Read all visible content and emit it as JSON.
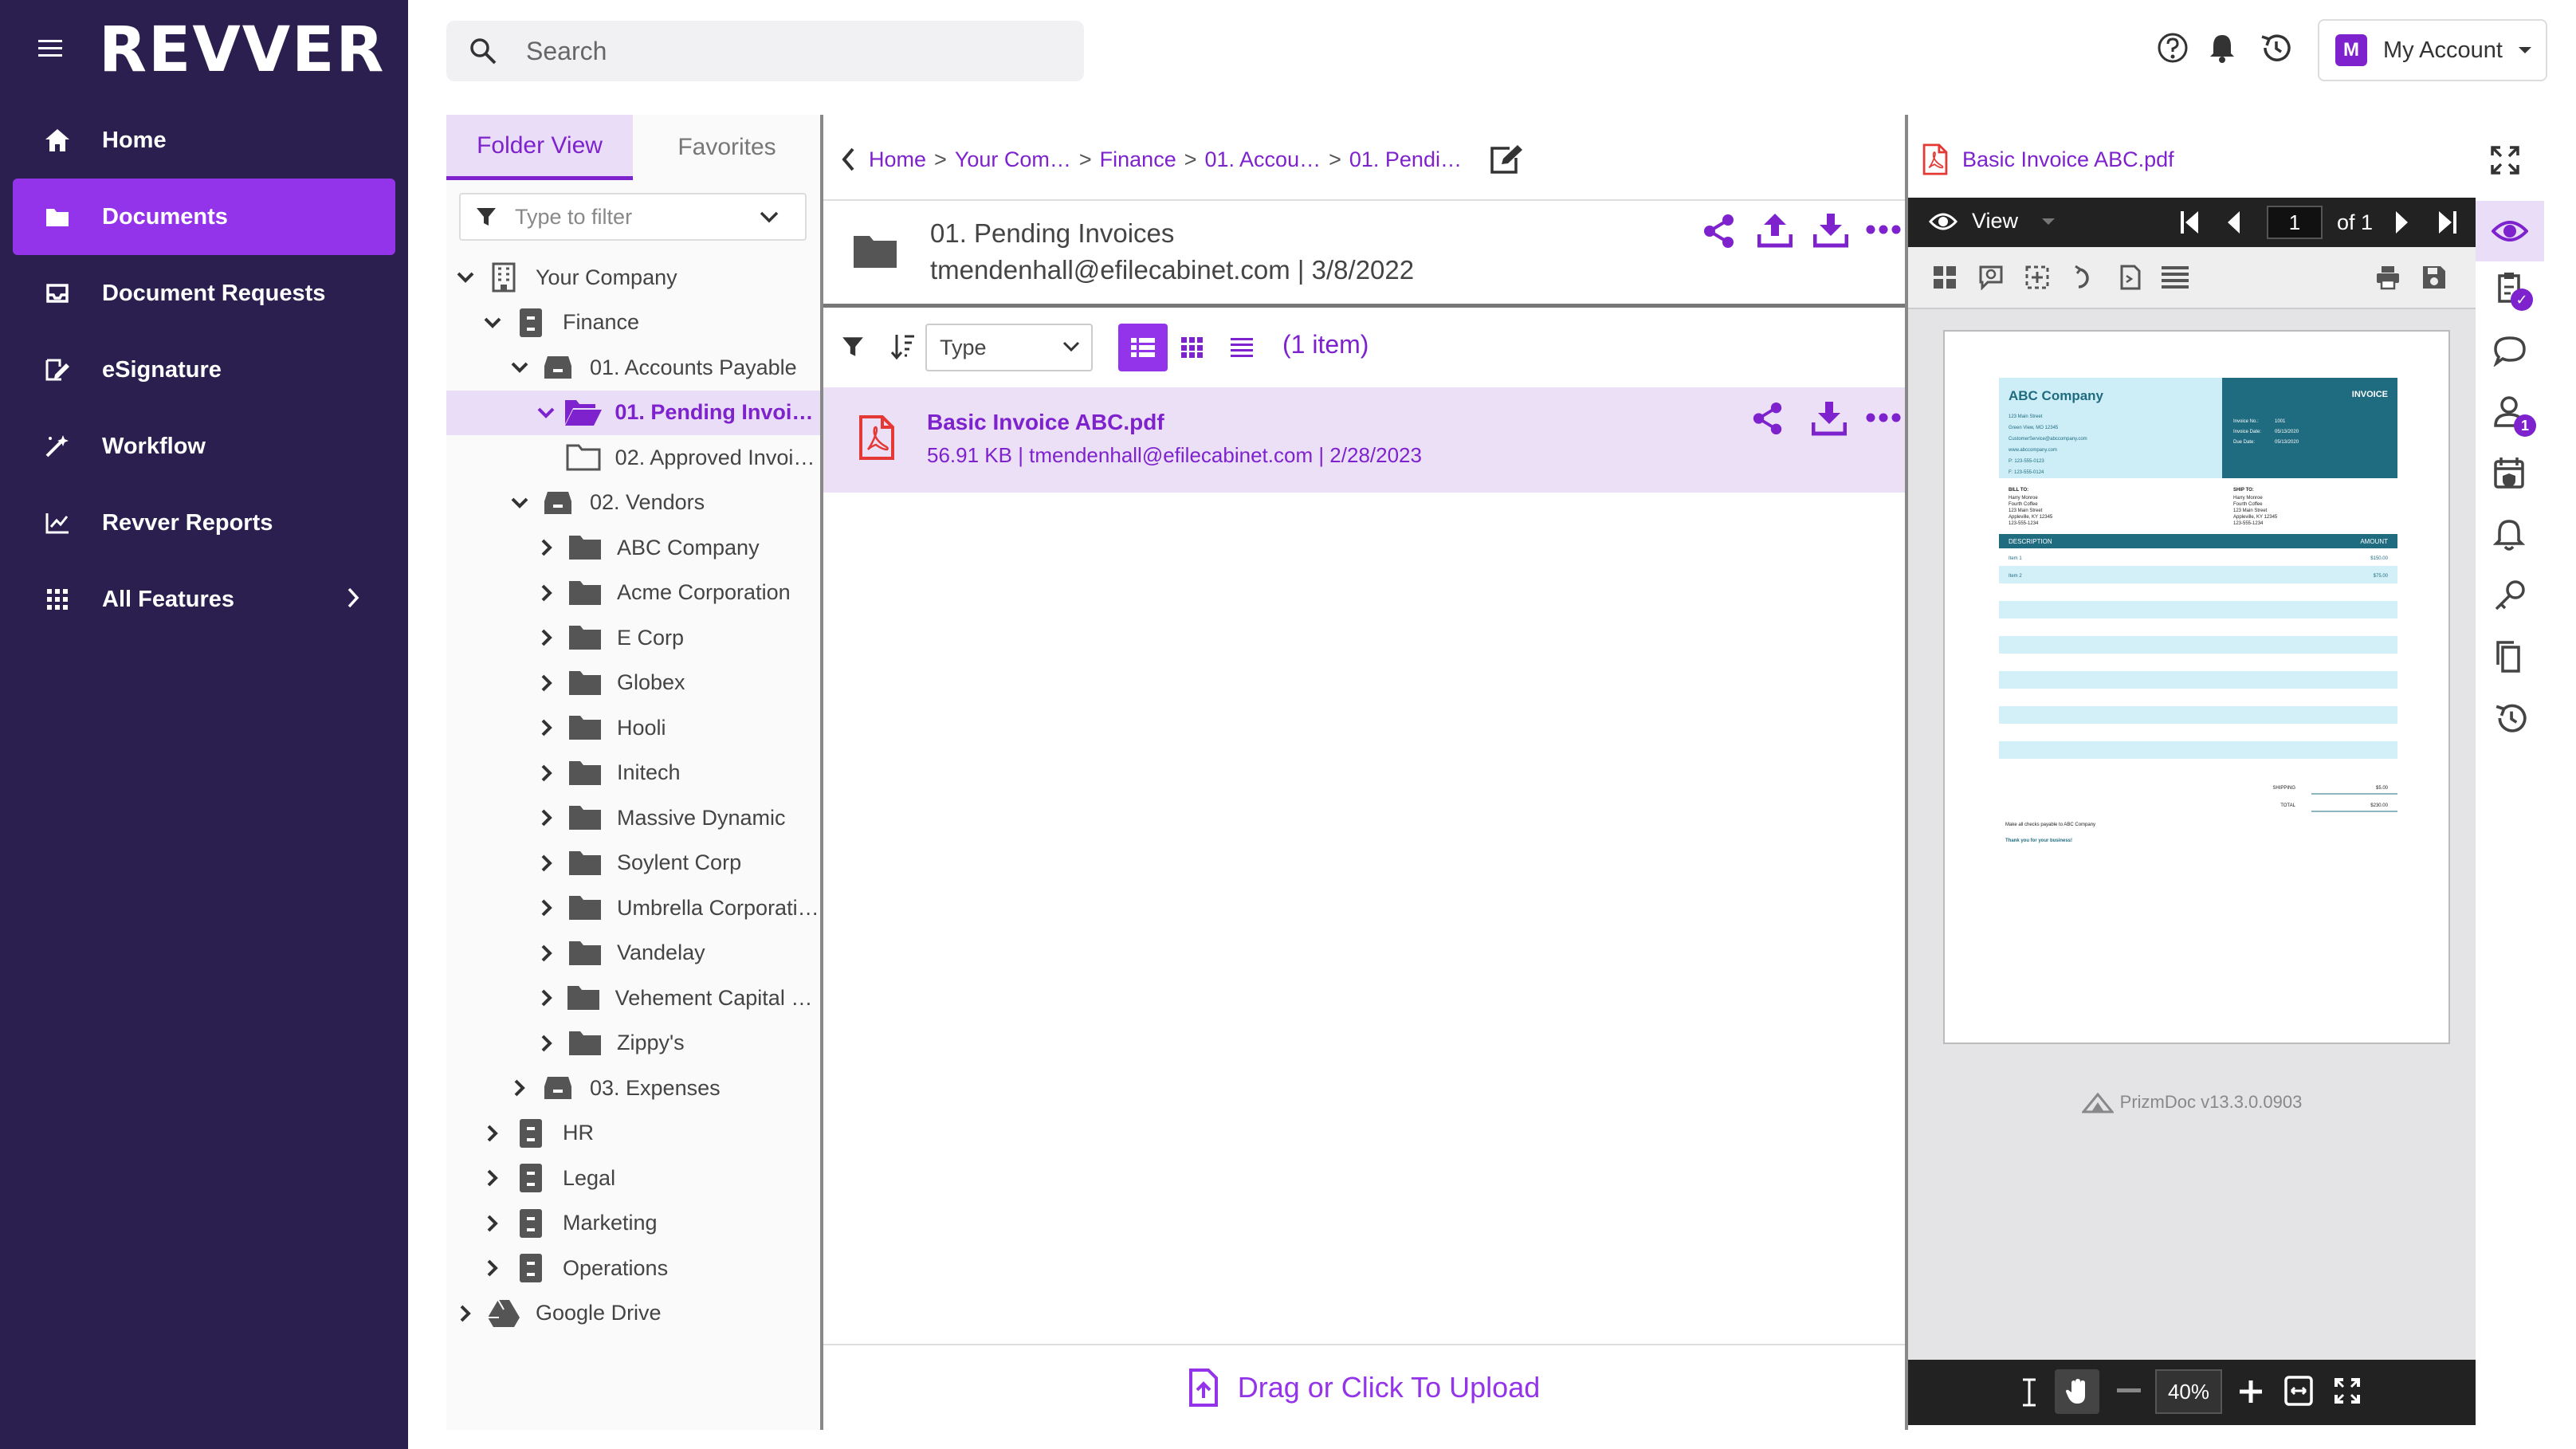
{
  "app": {
    "logo_text": "REVVER",
    "brand_color": "#7e22ce",
    "nav_bg": "#2a1f4e",
    "active_nav": "#9333ea"
  },
  "nav": {
    "items": [
      {
        "label": "Home",
        "icon": "home-icon"
      },
      {
        "label": "Documents",
        "icon": "folder-icon",
        "active": true
      },
      {
        "label": "Document Requests",
        "icon": "inbox-icon"
      },
      {
        "label": "eSignature",
        "icon": "signature-icon"
      },
      {
        "label": "Workflow",
        "icon": "magic-wand-icon"
      },
      {
        "label": "Revver Reports",
        "icon": "chart-icon"
      },
      {
        "label": "All Features",
        "icon": "grid-icon"
      }
    ]
  },
  "search": {
    "placeholder": "Search"
  },
  "account": {
    "initial": "M",
    "label": "My Account"
  },
  "tree": {
    "tabs": [
      "Folder View",
      "Favorites"
    ],
    "filter_placeholder": "Type to filter",
    "nodes": [
      {
        "label": "Your Company",
        "type": "building",
        "toggle": "open",
        "level": 0
      },
      {
        "label": "Finance",
        "type": "cabinet",
        "toggle": "open",
        "level": 1
      },
      {
        "label": "01. Accounts Payable",
        "type": "drawer",
        "toggle": "open",
        "level": 2
      },
      {
        "label": "01. Pending Invoices",
        "type": "folder-open",
        "toggle": "open",
        "level": 3,
        "selected": true
      },
      {
        "label": "02. Approved Invoices",
        "type": "folder-empty",
        "toggle": "none",
        "level": 3
      },
      {
        "label": "02. Vendors",
        "type": "drawer",
        "toggle": "open",
        "level": 2
      },
      {
        "label": "ABC Company",
        "type": "folder",
        "toggle": "closed",
        "level": 3
      },
      {
        "label": "Acme Corporation",
        "type": "folder",
        "toggle": "closed",
        "level": 3
      },
      {
        "label": "E Corp",
        "type": "folder",
        "toggle": "closed",
        "level": 3
      },
      {
        "label": "Globex",
        "type": "folder",
        "toggle": "closed",
        "level": 3
      },
      {
        "label": "Hooli",
        "type": "folder",
        "toggle": "closed",
        "level": 3
      },
      {
        "label": "Initech",
        "type": "folder",
        "toggle": "closed",
        "level": 3
      },
      {
        "label": "Massive Dynamic",
        "type": "folder",
        "toggle": "closed",
        "level": 3
      },
      {
        "label": "Soylent Corp",
        "type": "folder",
        "toggle": "closed",
        "level": 3
      },
      {
        "label": "Umbrella Corporati…",
        "type": "folder",
        "toggle": "closed",
        "level": 3
      },
      {
        "label": "Vandelay",
        "type": "folder",
        "toggle": "closed",
        "level": 3
      },
      {
        "label": "Vehement Capital P…",
        "type": "folder",
        "toggle": "closed",
        "level": 3
      },
      {
        "label": "Zippy's",
        "type": "folder",
        "toggle": "closed",
        "level": 3
      },
      {
        "label": "03. Expenses",
        "type": "drawer",
        "toggle": "closed",
        "level": 2
      },
      {
        "label": "HR",
        "type": "cabinet",
        "toggle": "closed",
        "level": 1
      },
      {
        "label": "Legal",
        "type": "cabinet",
        "toggle": "closed",
        "level": 1
      },
      {
        "label": "Marketing",
        "type": "cabinet",
        "toggle": "closed",
        "level": 1
      },
      {
        "label": "Operations",
        "type": "cabinet",
        "toggle": "closed",
        "level": 1
      },
      {
        "label": "Google Drive",
        "type": "gdrive",
        "toggle": "closed",
        "level": 0
      }
    ]
  },
  "breadcrumbs": [
    "Home",
    "Your Com…",
    "Finance",
    "01. Accou…",
    "01. Pendi…"
  ],
  "folder": {
    "name": "01. Pending Invoices",
    "meta": "tmendenhall@efilecabinet.com | 3/8/2022"
  },
  "toolbar": {
    "type_select": "Type",
    "count": "(1 item)"
  },
  "file": {
    "name": "Basic Invoice ABC.pdf",
    "meta": "56.91 KB | tmendenhall@efilecabinet.com | 2/28/2023"
  },
  "upload": {
    "label": "Drag or Click To Upload"
  },
  "viewer": {
    "title": "Basic Invoice ABC.pdf",
    "mode": "View",
    "page": "1",
    "of": "of 1",
    "zoom": "40%",
    "brand": "PrizmDoc v13.3.0.0903",
    "rail_badge": "1"
  },
  "invoice": {
    "company": "ABC Company",
    "heading": "INVOICE",
    "address": [
      "123 Main Street",
      "Green View, MO 12345",
      "CustomerService@abccompany.com",
      "www.abccompany.com",
      "P: 123-555-0123",
      "F: 123-555-0124"
    ],
    "meta_labels": [
      "Invoice No.:",
      "Invoice Date:",
      "Due Date:"
    ],
    "meta_values": [
      "1001",
      "05/13/2020",
      "05/13/2020"
    ],
    "bill_to_label": "BILL TO:",
    "bill_to": [
      "Harry Monroe",
      "Fourth Coffee",
      "123 Main Street",
      "Appleville, KY 12345",
      "123-555-1234"
    ],
    "ship_to_label": "SHIP TO:",
    "ship_to": [
      "Harry Monroe",
      "Fourth Coffee",
      "123 Main Street",
      "Appleville, KY 12345",
      "123-555-1234"
    ],
    "col_desc": "DESCRIPTION",
    "col_amount": "AMOUNT",
    "items": [
      {
        "d": "Item 1",
        "a": "$150.00"
      },
      {
        "d": "Item 2",
        "a": "$75.00"
      }
    ],
    "shipping_label": "SHIPPING",
    "shipping_value": "$5.00",
    "total_label": "TOTAL",
    "total_value": "$230.00",
    "note": "Make all checks payable to ABC Company",
    "thanks": "Thank you for your business!"
  }
}
